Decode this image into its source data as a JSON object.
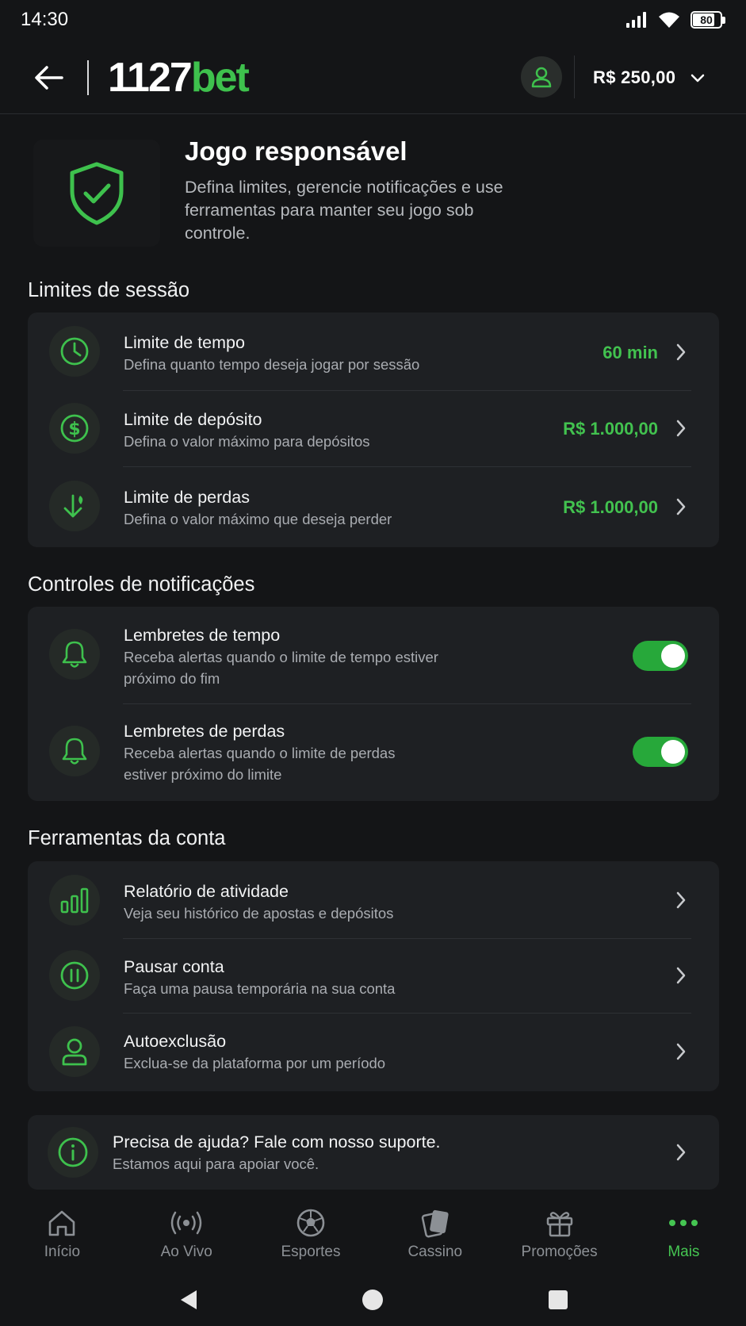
{
  "status_bar": {
    "time": "14:30",
    "battery": "80",
    "battery_percent": 80
  },
  "header": {
    "logo_number": "1127",
    "logo_word": "bet",
    "balance": "R$ 250,00"
  },
  "intro": {
    "title": "Jogo responsável",
    "description": "Defina limites, gerencie notificações e use ferramentas para manter seu jogo sob controle."
  },
  "session_limits": {
    "title": "Limites de sessão",
    "items": [
      {
        "icon": "clock-icon",
        "title": "Limite de tempo",
        "subtitle": "Defina quanto tempo deseja jogar por sessão",
        "value": "60 min"
      },
      {
        "icon": "dollar-icon",
        "title": "Limite de depósito",
        "subtitle": "Defina o valor máximo para depósitos",
        "value": "R$ 1.000,00"
      },
      {
        "icon": "loss-arrow-icon",
        "title": "Limite de perdas",
        "subtitle": "Defina o valor máximo que deseja perder",
        "value": "R$ 1.000,00"
      }
    ]
  },
  "notifications": {
    "title": "Controles de notificações",
    "items": [
      {
        "icon": "bell-icon",
        "title": "Lembretes de tempo",
        "subtitle": "Receba alertas quando o limite de tempo estiver próximo do fim",
        "enabled": true
      },
      {
        "icon": "bell-icon",
        "title": "Lembretes de perdas",
        "subtitle": "Receba alertas quando o limite de perdas estiver próximo do limite",
        "enabled": true
      }
    ]
  },
  "account_tools": {
    "title": "Ferramentas da conta",
    "items": [
      {
        "icon": "bar-chart-icon",
        "title": "Relatório de atividade",
        "subtitle": "Veja seu histórico de apostas e depósitos"
      },
      {
        "icon": "pause-icon",
        "title": "Pausar conta",
        "subtitle": "Faça uma pausa temporária na sua conta"
      },
      {
        "icon": "user-icon",
        "title": "Autoexclusão",
        "subtitle": "Exclua-se da plataforma por um período"
      }
    ]
  },
  "help": {
    "icon": "info-icon",
    "title": "Precisa de ajuda? Fale com nosso suporte.",
    "subtitle": "Estamos aqui para apoiar você."
  },
  "bottom_nav": [
    {
      "icon": "home-icon",
      "label": "Início",
      "active": false
    },
    {
      "icon": "live-icon",
      "label": "Ao Vivo",
      "active": false
    },
    {
      "icon": "soccer-ball-icon",
      "label": "Esportes",
      "active": false
    },
    {
      "icon": "cards-icon",
      "label": "Cassino",
      "active": false
    },
    {
      "icon": "gift-icon",
      "label": "Promoções",
      "active": false
    },
    {
      "icon": "more-dots-icon",
      "label": "Mais",
      "active": true
    }
  ],
  "colors": {
    "accent": "#3ec14d",
    "background": "#141517",
    "card": "#1e2023"
  }
}
